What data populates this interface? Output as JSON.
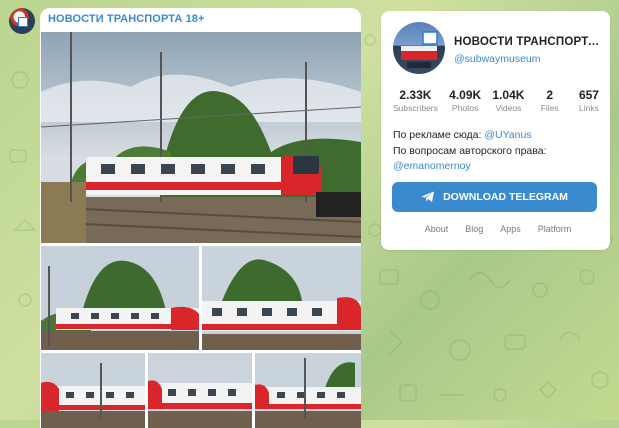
{
  "post": {
    "channel_title": "НОВОСТИ ТРАНСПОРТА 18+",
    "photo_count": 6
  },
  "channel": {
    "name": "НОВОСТИ ТРАНСПОРТА...",
    "handle": "@subwaymuseum",
    "stats": [
      {
        "value": "2.33K",
        "label": "Subscribers"
      },
      {
        "value": "4.09K",
        "label": "Photos"
      },
      {
        "value": "1.04K",
        "label": "Videos"
      },
      {
        "value": "2",
        "label": "Files"
      },
      {
        "value": "657",
        "label": "Links"
      }
    ],
    "ad_text": "По рекламе сюда:",
    "ad_contact": "@UYanus",
    "copyright_text": "По вопросам авторского права:",
    "copyright_contact": "@emanomernoy",
    "download_label": "DOWNLOAD TELEGRAM",
    "footer_links": [
      "About",
      "Blog",
      "Apps",
      "Platform"
    ]
  },
  "colors": {
    "accent": "#3a8ad0",
    "train_red": "#d9262b",
    "background": "#c3d98f"
  },
  "icons": {
    "download": "telegram-plane-icon"
  }
}
